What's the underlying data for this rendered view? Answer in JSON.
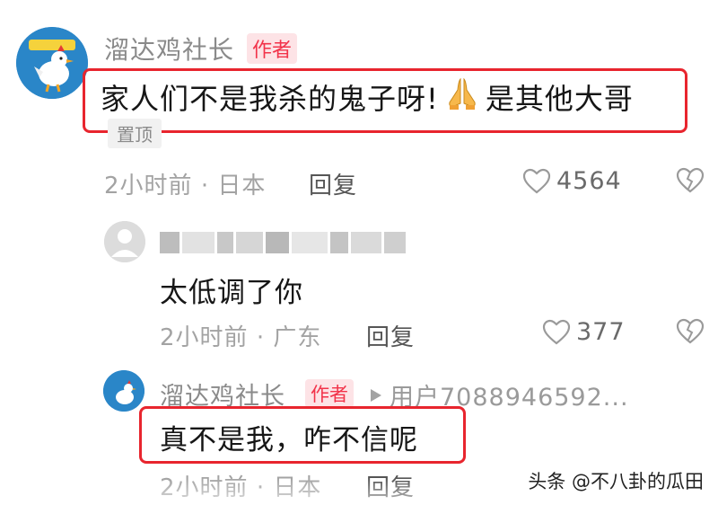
{
  "comment": {
    "author": "溜达鸡社长",
    "badge": "作者",
    "text_before": "家人们不是我杀的鬼子呀!",
    "text_after": "是其他大哥",
    "pinned_label": "置顶",
    "time": "2小时前",
    "location": "日本",
    "reply_label": "回复",
    "likes": "4564"
  },
  "replies": [
    {
      "author": "",
      "text": "太低调了你",
      "time": "2小时前",
      "location": "广东",
      "reply_label": "回复",
      "likes": "377"
    },
    {
      "author": "溜达鸡社长",
      "badge": "作者",
      "reply_to": "用户7088946592...",
      "text": "真不是我，咋不信呢",
      "time": "2小时前",
      "location": "日本",
      "reply_label": "回复"
    }
  ],
  "watermark": "头条 @不八卦的瓜田",
  "colors": {
    "highlight_box": "#e8252e",
    "badge_text": "#f2334a",
    "badge_bg": "#fde3e6",
    "avatar_blue": "#2a86c8"
  },
  "icons": [
    "heart-outline-icon",
    "broken-heart-icon",
    "praying-hands-emoji",
    "play-arrow-icon"
  ]
}
